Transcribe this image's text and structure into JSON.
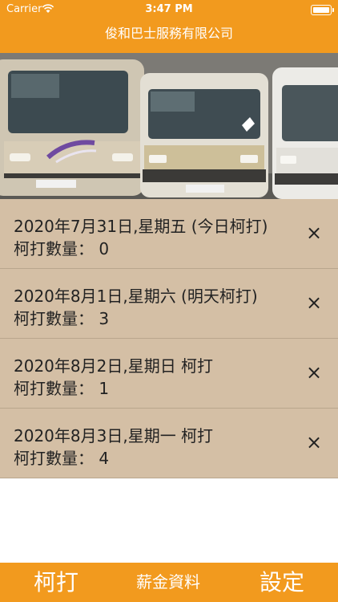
{
  "status": {
    "carrier": "Carrier",
    "time": "3:47 PM"
  },
  "nav": {
    "title": "俊和巴士服務有限公司"
  },
  "colors": {
    "accent": "#f29a1e",
    "row_bg": "#d4bfa5"
  },
  "banner": {
    "icon": "bus-photo"
  },
  "items": [
    {
      "title": "2020年7月31日,星期五 (今日柯打)",
      "count": "柯打數量： 0",
      "close": "×"
    },
    {
      "title": "2020年8月1日,星期六 (明天柯打)",
      "count": "柯打數量： 3",
      "close": "×"
    },
    {
      "title": "2020年8月2日,星期日 柯打",
      "count": "柯打數量： 1",
      "close": "×"
    },
    {
      "title": "2020年8月3日,星期一 柯打",
      "count": "柯打數量： 4",
      "close": "×"
    }
  ],
  "tabs": [
    {
      "label": "柯打"
    },
    {
      "label": "薪金資料"
    },
    {
      "label": "設定"
    }
  ]
}
